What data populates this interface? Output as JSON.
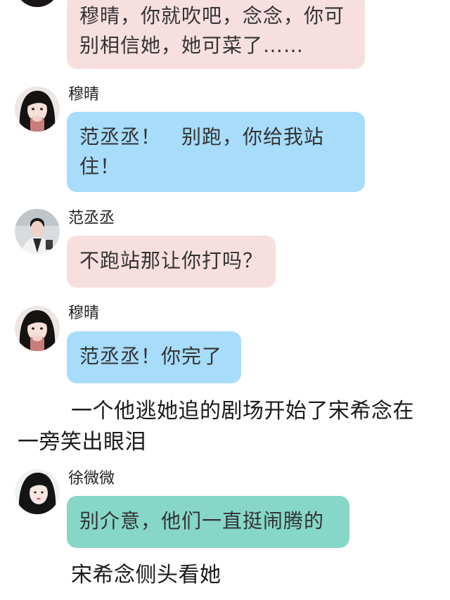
{
  "colors": {
    "pink_bubble": "#f7dfe0",
    "blue_bubble": "#a7dcfb",
    "teal_bubble": "#86d7c8",
    "background": "#ffffff"
  },
  "messages": [
    {
      "sender": "",
      "avatar_icon": "girl-avatar-icon",
      "text": "穆晴，你就吹吧，念念，你可别相信她，她可菜了……",
      "bubble_color": "pink"
    },
    {
      "sender": "穆晴",
      "avatar_icon": "girl-avatar-icon",
      "text": "范丞丞！　别跑，你给我站住！",
      "bubble_color": "blue"
    },
    {
      "sender": "范丞丞",
      "avatar_icon": "boy-avatar-icon",
      "text": "不跑站那让你打吗？",
      "bubble_color": "pink"
    },
    {
      "sender": "穆晴",
      "avatar_icon": "girl-avatar-icon",
      "text": "范丞丞！你完了",
      "bubble_color": "blue"
    },
    {
      "sender": "徐微微",
      "avatar_icon": "girl-avatar-icon",
      "text": "别介意，他们一直挺闹腾的",
      "bubble_color": "teal"
    }
  ],
  "narration": [
    "一个他逃她追的剧场开始了宋希念在一旁笑出眼泪",
    "宋希念侧头看她"
  ]
}
